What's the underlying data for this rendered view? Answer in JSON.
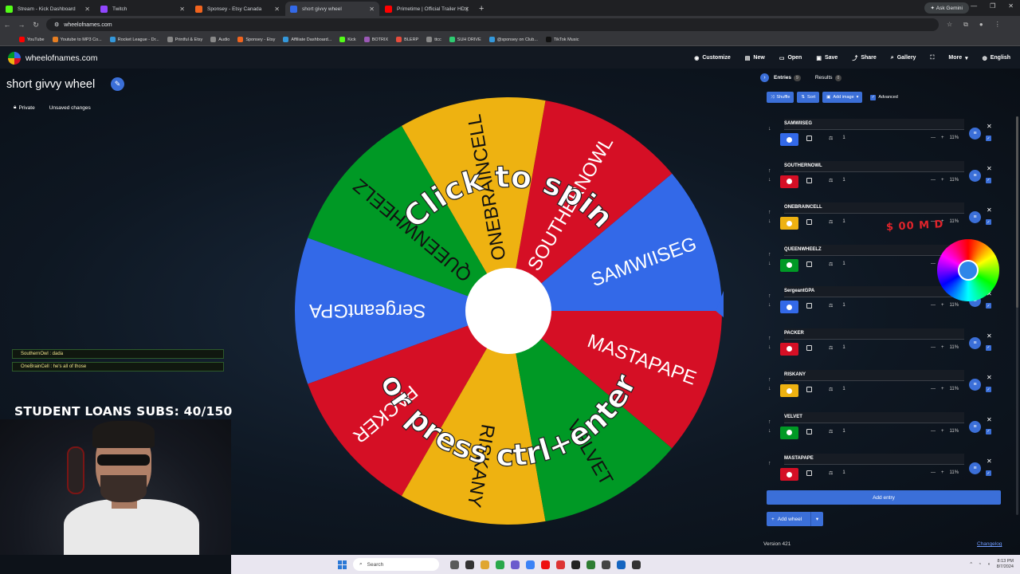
{
  "browser": {
    "tabs": [
      {
        "title": "Stream - Kick Dashboard",
        "color": "#53fc18",
        "active": false
      },
      {
        "title": "Twitch",
        "color": "#9146ff",
        "active": false
      },
      {
        "title": "Sponsey - Etsy Canada",
        "color": "#f1641e",
        "active": false
      },
      {
        "title": "short givvy wheel",
        "color": "#3369e8",
        "active": true
      },
      {
        "title": "Primetime | Official Trailer HD |",
        "color": "#ff0000",
        "active": false
      }
    ],
    "ask_gemini": "Ask Gemini",
    "url": "wheelofnames.com",
    "bookmarks": [
      "YouTube",
      "Youtube to MP3 Co...",
      "Rocket League - Dr...",
      "Printful & Etsy",
      "Audio",
      "Sponsey - Etsy",
      "Affiliate Dashboard...",
      "Kick",
      "BOTRIX",
      "BLERP",
      "ttcc",
      "SUH DRIVE",
      "@sponsey on Club...",
      "TikTok Music"
    ]
  },
  "site": {
    "name": "wheelofnames.com",
    "menu": [
      "Customize",
      "New",
      "Open",
      "Save",
      "Share",
      "Gallery",
      "",
      "More",
      "English"
    ]
  },
  "wheel": {
    "title": "short givvy wheel",
    "private_label": "Private",
    "unsaved_label": "Unsaved changes",
    "overlay_line1": "Click to spin",
    "overlay_line2": "or press ctrl+enter",
    "segments": [
      "SAMWIISEG",
      "SOUTHERNOWL",
      "ONEBRAINCELL",
      "QUEENWHEELZ",
      "SergeantGPA",
      "PACKER",
      "RISKANY",
      "VELVET",
      "MASTAPAPE"
    ],
    "colors": [
      "#3369e8",
      "#d50f25",
      "#eeb211",
      "#009925",
      "#3369e8",
      "#d50f25",
      "#eeb211",
      "#009925",
      "#d50f25"
    ]
  },
  "stream": {
    "chat": [
      "SouthernOwl : dada",
      "OneBrainCell : he's all of those"
    ],
    "subs_banner": "STUDENT LOANS SUBS: 40/150",
    "scribble": "$ 00 M D"
  },
  "panel": {
    "entries_tab": "Entries",
    "entries_count": "9",
    "results_tab": "Results",
    "results_count": "0",
    "shuffle": "Shuffle",
    "sort": "Sort",
    "add_image": "Add image",
    "advanced": "Advanced",
    "entries": [
      {
        "name": "SAMWIISEG",
        "color": "#3369e8",
        "weight": "1",
        "pct": "11%"
      },
      {
        "name": "SOUTHERNOWL",
        "color": "#d50f25",
        "weight": "1",
        "pct": "11%"
      },
      {
        "name": "ONEBRAINCELL",
        "color": "#eeb211",
        "weight": "1",
        "pct": "11%"
      },
      {
        "name": "QUEENWHEELZ",
        "color": "#009925",
        "weight": "1",
        "pct": ""
      },
      {
        "name": "SergeantGPA",
        "color": "#3369e8",
        "weight": "1",
        "pct": "11%"
      },
      {
        "name": "PACKER",
        "color": "#d50f25",
        "weight": "1",
        "pct": "11%"
      },
      {
        "name": "RISKANY",
        "color": "#eeb211",
        "weight": "1",
        "pct": "11%"
      },
      {
        "name": "VELVET",
        "color": "#009925",
        "weight": "1",
        "pct": "11%"
      },
      {
        "name": "MASTAPAPE",
        "color": "#d50f25",
        "weight": "1",
        "pct": "11%"
      }
    ],
    "add_entry": "Add entry",
    "add_wheel": "Add wheel",
    "version": "Version 421",
    "changelog": "Changelog"
  },
  "taskbar": {
    "search": "Search",
    "time": "8:13 PM",
    "date": "8/7/2024"
  }
}
